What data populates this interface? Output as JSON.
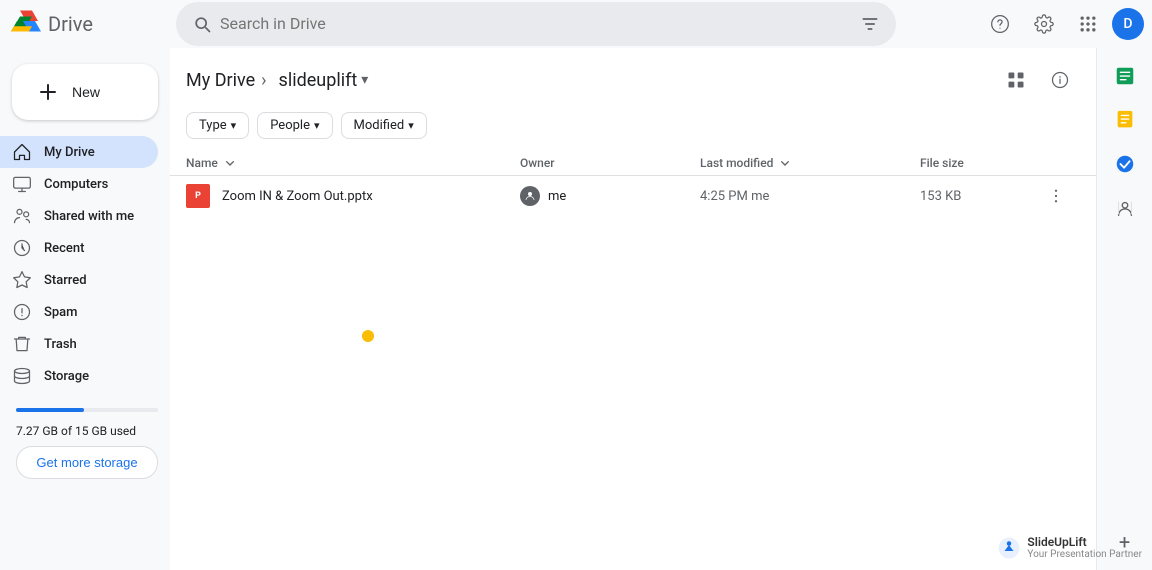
{
  "app": {
    "title": "Drive",
    "logo_text": "Drive"
  },
  "topbar": {
    "search_placeholder": "Search in Drive",
    "help_label": "Help",
    "settings_label": "Settings",
    "apps_label": "Google apps",
    "avatar_initial": "D"
  },
  "sidebar": {
    "new_button": "New",
    "items": [
      {
        "id": "my-drive",
        "label": "My Drive",
        "active": true
      },
      {
        "id": "computers",
        "label": "Computers",
        "active": false
      },
      {
        "id": "shared",
        "label": "Shared with me",
        "active": false
      },
      {
        "id": "recent",
        "label": "Recent",
        "active": false
      },
      {
        "id": "starred",
        "label": "Starred",
        "active": false
      },
      {
        "id": "spam",
        "label": "Spam",
        "active": false
      },
      {
        "id": "trash",
        "label": "Trash",
        "active": false
      },
      {
        "id": "storage",
        "label": "Storage",
        "active": false
      }
    ],
    "storage_used": "7.27 GB of 15 GB used",
    "storage_percent": 48,
    "get_more_storage": "Get more storage"
  },
  "breadcrumb": {
    "parent": "My Drive",
    "current": "slideuplift",
    "chevron": "▾"
  },
  "filters": {
    "type_label": "Type",
    "people_label": "People",
    "modified_label": "Modified",
    "dropdown_arrow": "▾"
  },
  "table": {
    "headers": {
      "name": "Name",
      "owner": "Owner",
      "last_modified": "Last modified",
      "file_size": "File size"
    },
    "rows": [
      {
        "icon": "pptx",
        "name": "Zoom IN & Zoom Out.pptx",
        "owner": "me",
        "modified_time": "4:25 PM",
        "modified_by": "me",
        "file_size": "153 KB"
      }
    ]
  },
  "right_panel": {
    "icons": [
      {
        "name": "sheets-icon",
        "color": "#0F9D58"
      },
      {
        "name": "keep-icon",
        "color": "#FBBC04"
      },
      {
        "name": "tasks-icon",
        "color": "#1A73E8"
      },
      {
        "name": "contacts-icon",
        "color": "#5F6368"
      }
    ],
    "plus_label": "+"
  },
  "watermark": {
    "brand": "SlideUpLift",
    "tagline": "Your Presentation Partner"
  }
}
